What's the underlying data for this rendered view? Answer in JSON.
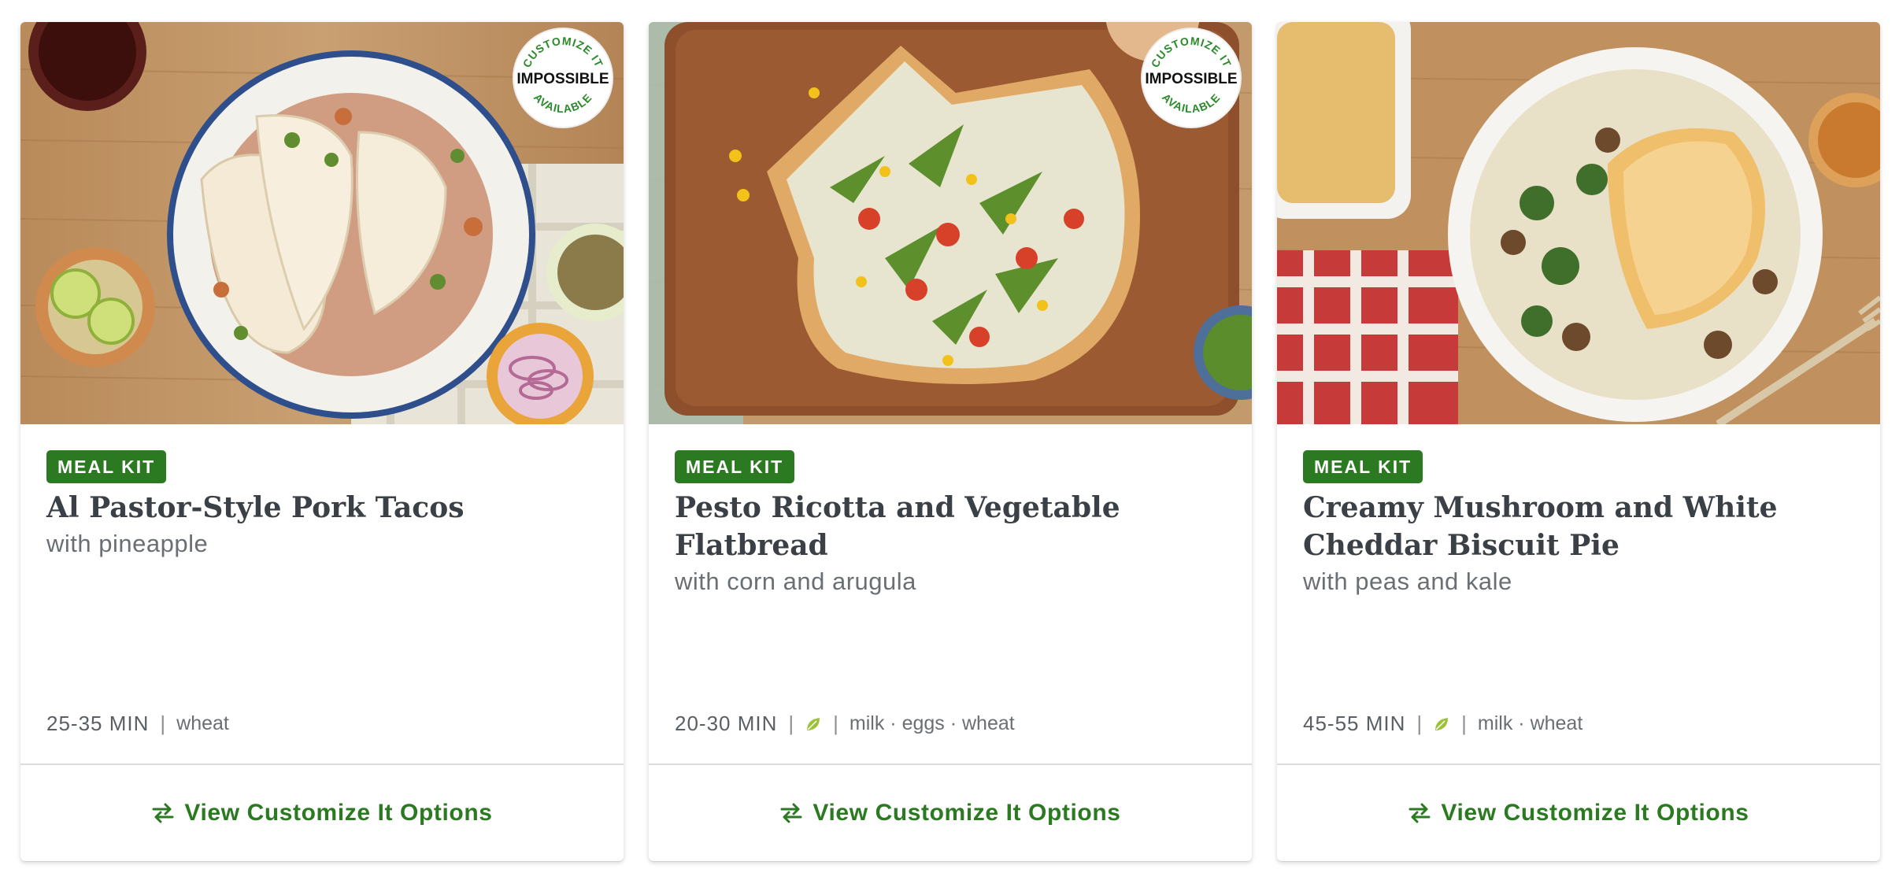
{
  "cards": [
    {
      "photo_alt": "Al Pastor-Style Pork Tacos",
      "has_impossible_badge": true,
      "impossible_badge": {
        "top_text": "CUSTOMIZE IT",
        "brand": "IMPOSSIBLE",
        "bottom_text": "AVAILABLE"
      },
      "tag": "MEAL KIT",
      "title": "Al Pastor-Style Pork Tacos",
      "subtitle": "with pineapple",
      "time": "25-35 MIN",
      "vegetarian": false,
      "allergens": "wheat",
      "cta": "View Customize It Options"
    },
    {
      "photo_alt": "Pesto Ricotta and Vegetable Flatbread",
      "has_impossible_badge": true,
      "impossible_badge": {
        "top_text": "CUSTOMIZE IT",
        "brand": "IMPOSSIBLE",
        "bottom_text": "AVAILABLE"
      },
      "tag": "MEAL KIT",
      "title": "Pesto Ricotta and Vegetable Flatbread",
      "subtitle": "with corn and arugula",
      "time": "20-30 MIN",
      "vegetarian": true,
      "allergens": "milk · eggs · wheat",
      "cta": "View Customize It Options"
    },
    {
      "photo_alt": "Creamy Mushroom and White Cheddar Biscuit Pie",
      "has_impossible_badge": false,
      "tag": "MEAL KIT",
      "title": "Creamy Mushroom and White Cheddar Biscuit Pie",
      "subtitle": "with peas and kale",
      "time": "45-55 MIN",
      "vegetarian": true,
      "allergens": "milk · wheat",
      "cta": "View Customize It Options"
    }
  ],
  "colors": {
    "accent_green": "#2b7a22",
    "leaf_green": "#9cc23a"
  },
  "icons": {
    "swap": "swap-arrows-icon",
    "vegetarian": "leaf-icon"
  }
}
